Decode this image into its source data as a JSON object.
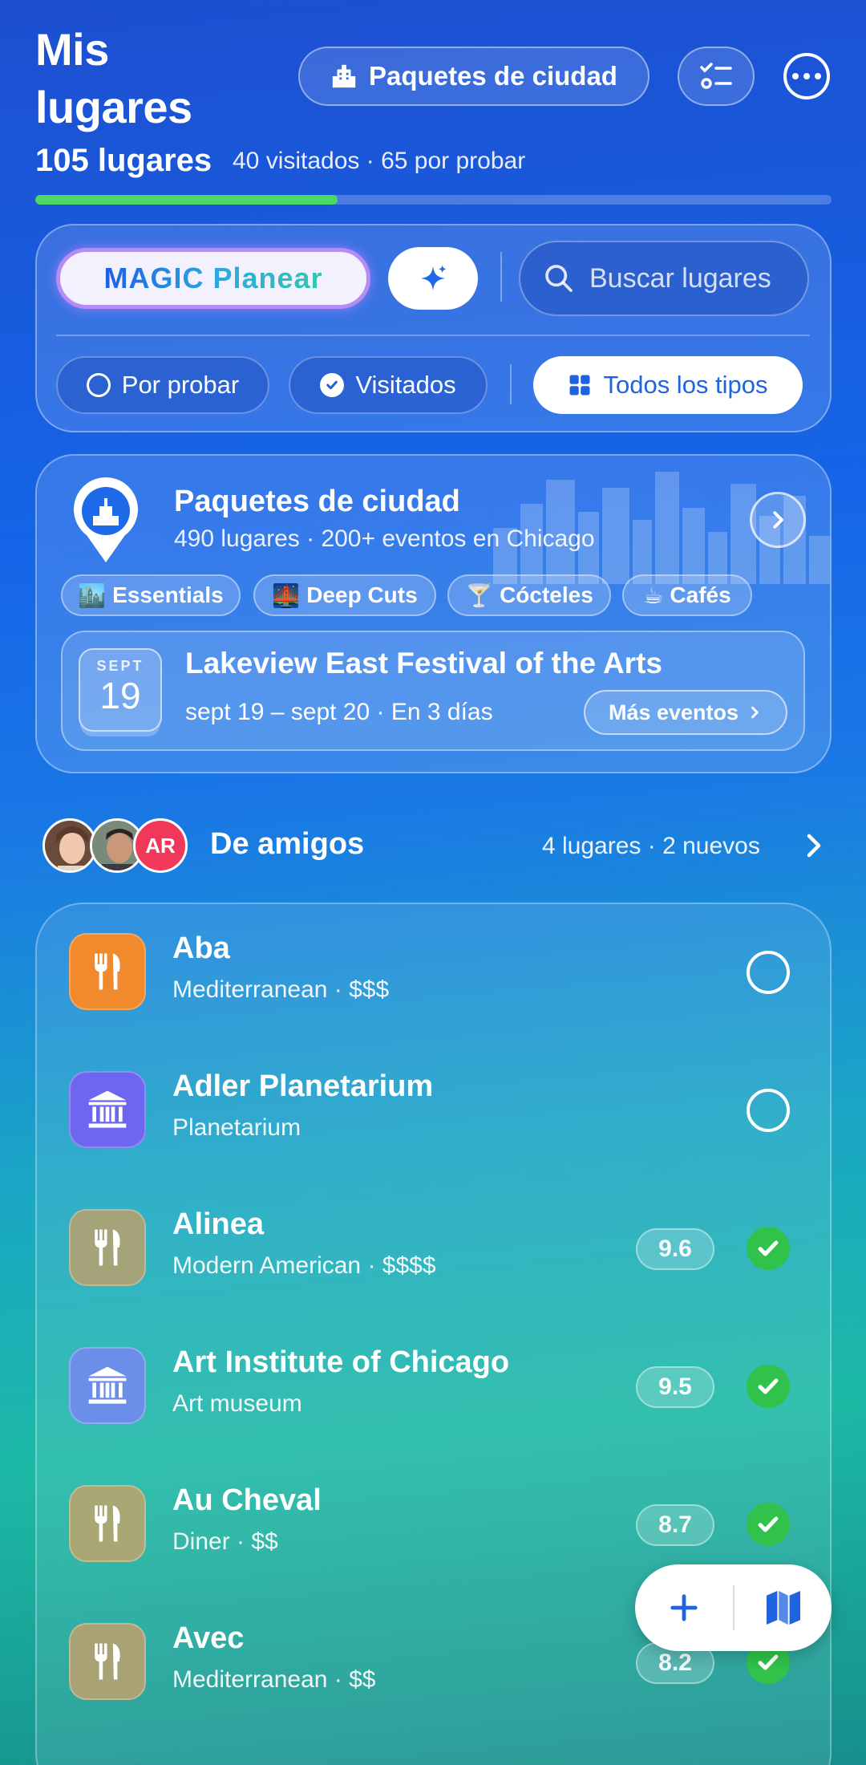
{
  "header": {
    "title": "Mis lugares",
    "city_packs_label": "Paquetes de ciudad",
    "count_label": "105 lugares",
    "count_sub": "40 visitados · 65 por probar",
    "progress_fraction": 0.38
  },
  "search": {
    "magic_label": "MAGIC Planear",
    "placeholder": "Buscar lugares",
    "filters": {
      "to_try": "Por probar",
      "visited": "Visitados",
      "all_types": "Todos los tipos"
    }
  },
  "city_pack": {
    "title": "Paquetes de ciudad",
    "subtitle": "490 lugares · 200+ eventos en Chicago",
    "tags": [
      {
        "emoji": "🏙️",
        "label": "Essentials"
      },
      {
        "emoji": "🌉",
        "label": "Deep Cuts"
      },
      {
        "emoji": "🍸",
        "label": "Cócteles"
      },
      {
        "emoji": "☕",
        "label": "Cafés"
      }
    ],
    "event": {
      "month": "SEPT",
      "day": "19",
      "title": "Lakeview East Festival of the Arts",
      "dates": "sept 19 – sept 20 · En 3 días",
      "more_label": "Más eventos"
    }
  },
  "friends": {
    "title": "De amigos",
    "initials": "AR",
    "summary": "4 lugares · 2 nuevos"
  },
  "places": [
    {
      "name": "Aba",
      "sub": "Mediterranean · $$$",
      "icon": "fork-knife-icon",
      "color": "#f08a2c",
      "visited": false,
      "score": ""
    },
    {
      "name": "Adler Planetarium",
      "sub": "Planetarium",
      "icon": "museum-icon",
      "color": "#6d66f0",
      "visited": false,
      "score": ""
    },
    {
      "name": "Alinea",
      "sub": "Modern American · $$$$",
      "icon": "fork-knife-icon",
      "color": "#a5a37a",
      "visited": true,
      "score": "9.6"
    },
    {
      "name": "Art Institute of Chicago",
      "sub": "Art museum",
      "icon": "museum-icon",
      "color": "#6b8fe8",
      "visited": true,
      "score": "9.5"
    },
    {
      "name": "Au Cheval",
      "sub": "Diner · $$",
      "icon": "fork-knife-icon",
      "color": "#a9a875",
      "visited": true,
      "score": "8.7"
    },
    {
      "name": "Avec",
      "sub": "Mediterranean · $$",
      "icon": "fork-knife-icon",
      "color": "#a9a275",
      "visited": true,
      "score": "8.2"
    }
  ]
}
